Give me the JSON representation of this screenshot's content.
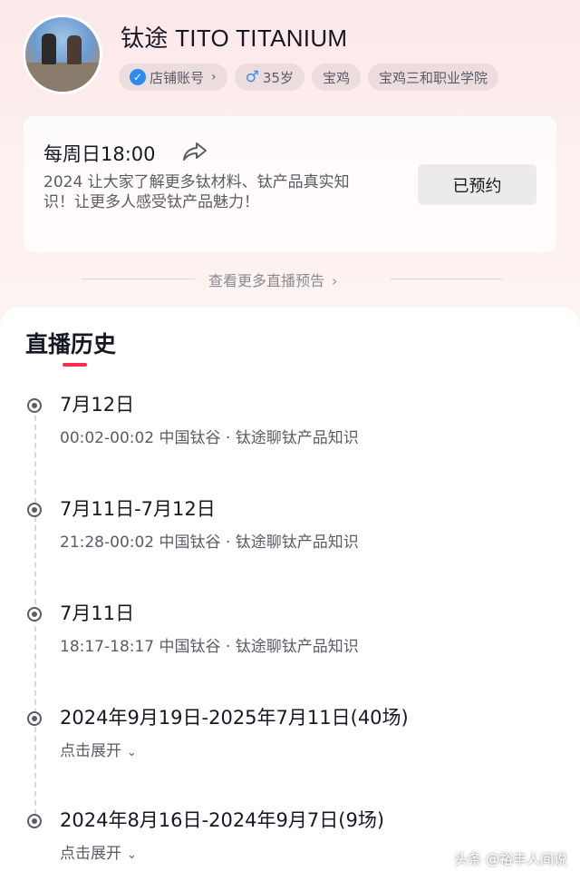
{
  "profile": {
    "username": "钛途 TITO TITANIUM",
    "tags": [
      {
        "label": "店铺账号",
        "icon": "verified-icon",
        "has_chevron": true
      },
      {
        "label": "35岁",
        "icon": "male-icon"
      },
      {
        "label": "宝鸡"
      },
      {
        "label": "宝鸡三和职业学院"
      }
    ]
  },
  "live_preview": {
    "time": "每周日18:00",
    "description": "2024 让大家了解更多钛材料、钛产品真实知识！让更多人感受钛产品魅力！",
    "reserve_button": "已预约",
    "more_link": "查看更多直播预告"
  },
  "history": {
    "title": "直播历史",
    "entries": [
      {
        "date": "7月12日",
        "detail": "00:02-00:02 中国钛谷 · 钛途聊钛产品知识"
      },
      {
        "date": "7月11日-7月12日",
        "detail": "21:28-00:02 中国钛谷 · 钛途聊钛产品知识"
      },
      {
        "date": "7月11日",
        "detail": "18:17-18:17 中国钛谷 · 钛途聊钛产品知识"
      },
      {
        "date": "2024年9月19日-2025年7月11日(40场)",
        "expand": "点击展开"
      },
      {
        "date": "2024年8月16日-2024年9月7日(9场)",
        "expand": "点击展开"
      }
    ]
  },
  "watermark": "头条 @裕丰人间说",
  "colors": {
    "accent": "#fe2c55",
    "verified": "#2c8cf4",
    "male": "#3c8ef5"
  }
}
